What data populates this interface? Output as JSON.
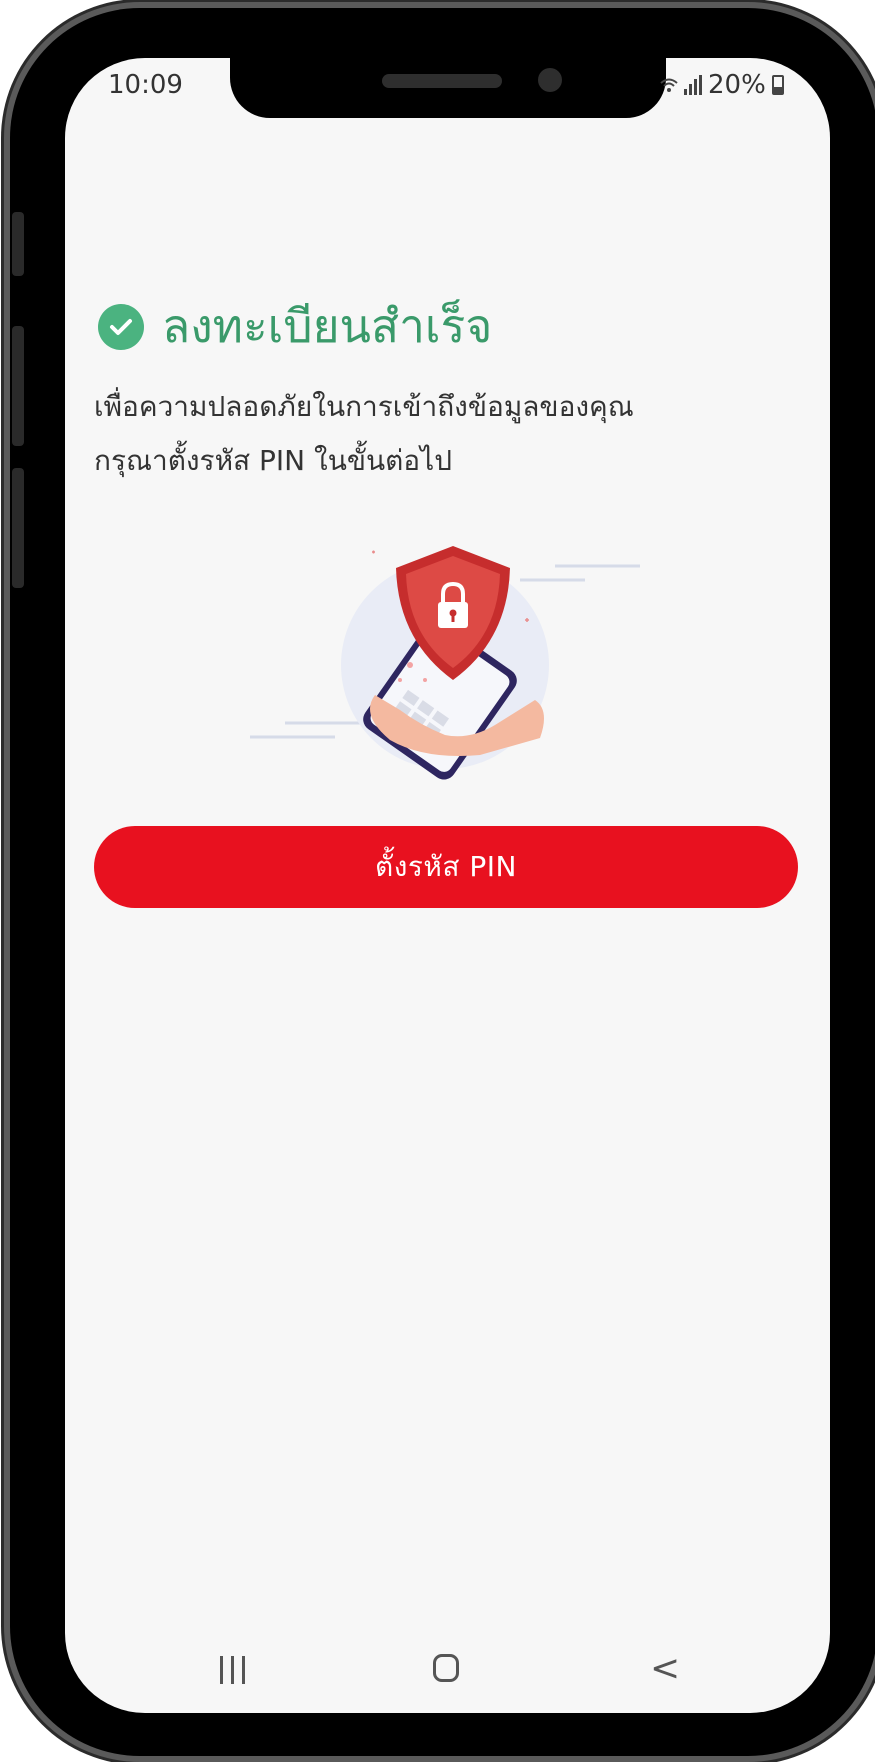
{
  "status_bar": {
    "time": "10:09",
    "battery_text": "20%",
    "icons": [
      "wifi-icon",
      "signal-icon",
      "battery-icon"
    ]
  },
  "content": {
    "title": "ลงทะเบียนสำเร็จ",
    "title_color": "#3a9a6a",
    "description_line1": "เพื่อความปลอดภัยในการเข้าถึงข้อมูลของคุณ",
    "description_line2": "กรุณาตั้งรหัส PIN ในขั้นต่อไป",
    "illustration_icon": "phone-shield-lock-illustration"
  },
  "actions": {
    "set_pin_label": "ตั้งรหัส PIN",
    "button_color": "#e8111f"
  },
  "nav_bar": {
    "recent_icon": "recent-apps-icon",
    "home_icon": "home-icon",
    "back_icon": "back-icon",
    "back_glyph": "<"
  }
}
